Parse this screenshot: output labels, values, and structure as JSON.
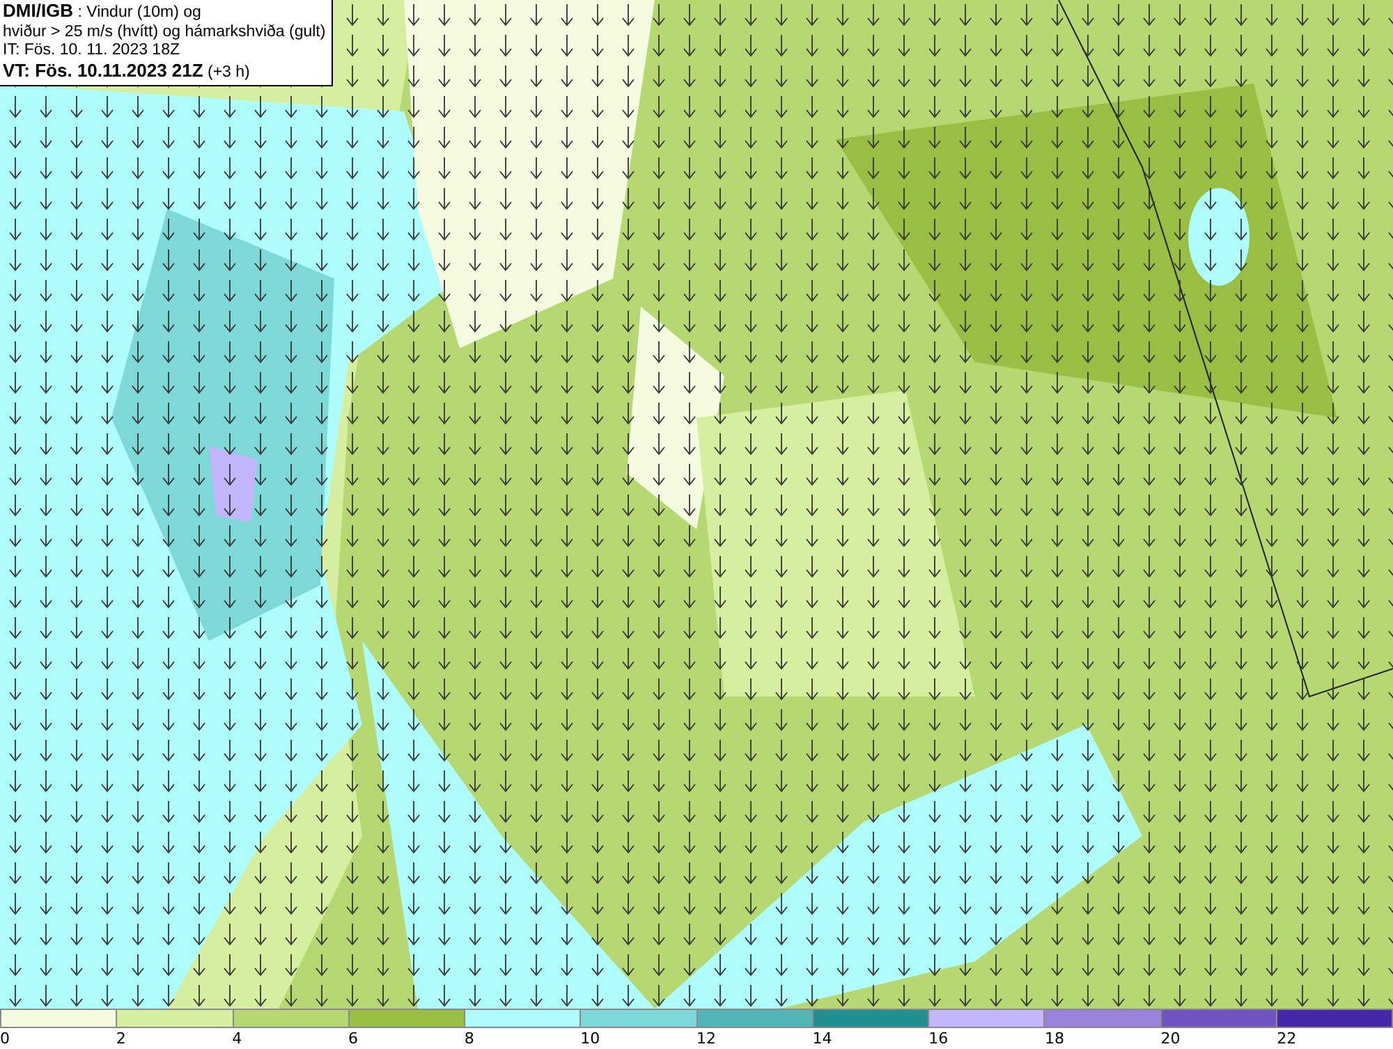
{
  "title_box": {
    "lines": [
      "**DMI/IGB** : Vindur (10m) og",
      "hviður > 25 m/s (hvítt) og hámarkshviða (gult)",
      "IT: Fös. 10. 11. 2023 18Z",
      "**VT: Fös. 10.11.2023 21Z** (+3 h)"
    ]
  },
  "legend": [
    {
      "label": "0",
      "color": "#f4fbe0"
    },
    {
      "label": "2",
      "color": "#d6eea0"
    },
    {
      "label": "4",
      "color": "#b6d872"
    },
    {
      "label": "6",
      "color": "#98bf43"
    },
    {
      "label": "8",
      "color": "#aefcfc"
    },
    {
      "label": "10",
      "color": "#7ed8d8"
    },
    {
      "label": "12",
      "color": "#52b4b4"
    },
    {
      "label": "14",
      "color": "#229090"
    },
    {
      "label": "16",
      "color": "#c4b6fc"
    },
    {
      "label": "18",
      "color": "#9a82dc"
    },
    {
      "label": "20",
      "color": "#7254c0"
    },
    {
      "label": "22",
      "color": "#4426a6"
    }
  ]
}
